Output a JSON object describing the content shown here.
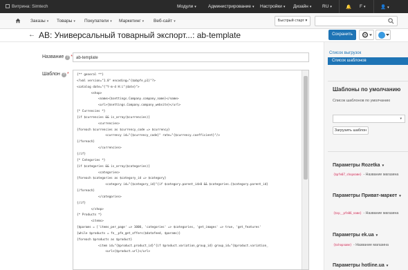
{
  "topbar": {
    "store_label": "Витрина: Simtech",
    "items": [
      "Модули",
      "Администрирование",
      "Настройки",
      "Дизайн",
      "RU"
    ],
    "user_initial": "",
    "user_caret": "F"
  },
  "nav": {
    "items": [
      "Заказы",
      "Товары",
      "Покупатели",
      "Маркетинг",
      "Веб-сайт"
    ],
    "quick_start": "Быстрый старт"
  },
  "page": {
    "title": "AB: Универсальный товарный экспорт...: ab-template",
    "save_label": "Сохранить"
  },
  "form": {
    "name_label": "Название",
    "name_value": "ab-template",
    "template_label": "Шаблон",
    "required_mark": "*",
    "code_lines": [
      "{** general **}",
      "<?xml version=\"1.0\" encoding=\"{$abpfe_p1}\"?>",
      "<catalog date=\"{\"Y-m-d H:i\"|date}\">",
      "        <shop>",
      "            <name>{$settings.Company.company_name}</name>",
      "            <url>{$settings.Company.company_website}</url>",
      "{* Currencies *}",
      "{if $currencies && is_array($currencies)}",
      "            <currencies>",
      "{foreach $currencies as $currency_code => $currency}",
      "                <currency id=\"{$currency_code}\" rate=\"{$currency.coefficient}\"/>",
      "{/foreach}",
      "            </currencies>",
      "{/if}",
      "{* Categories *}",
      "{if $categories && is_array($categories)}",
      "            <categories>",
      "{foreach $categories as $category_id => $category}",
      "                <category id=\"{$category_id}\"{if $category.parent_id>0 && $categories.{$category.parent_id}",
      "{/foreach}",
      "            </categories>",
      "{/if}",
      "        </shop>",
      "{* Products *}",
      "        <items>",
      "{$params = ['items_per_page' => 1000, 'categories' => $categories, 'get_images' => true, 'get_features'",
      "{while $products = fn__pfe_get_offers($datafeed, $params)}",
      "{foreach $products as $product}",
      "            <item id=\"{$product.product_id}\"{if $product.variation_group_id} group_id=\"{$product.variation_",
      "                <url>{$product.url}</url>"
    ]
  },
  "sidebar": {
    "link_exports": "Список выгрузок",
    "link_templates": "Список шаблонов",
    "default_title": "Шаблоны по умолчанию",
    "default_sub": "Список шаблонов по умолчанию",
    "load_button": "Загрузить шаблон",
    "params": [
      {
        "prefix": "Параметры",
        "name": "Rozetka",
        "code": "{$pfe07_shopname}",
        "desc": "- Название магазина"
      },
      {
        "prefix": "Параметры",
        "name": "Приват-маркет",
        "code": "{$sp__pfe06_name}",
        "desc": "- Название магазина"
      },
      {
        "prefix": "Параметры",
        "name": "ek.ua",
        "code": "{$shopname}",
        "desc": "- Название магазина"
      },
      {
        "prefix": "Параметры",
        "name": "hotline.ua",
        "code": "",
        "desc": ""
      }
    ]
  },
  "colors": {
    "accent": "#1e74b5",
    "topbar": "#2a2a2a"
  }
}
